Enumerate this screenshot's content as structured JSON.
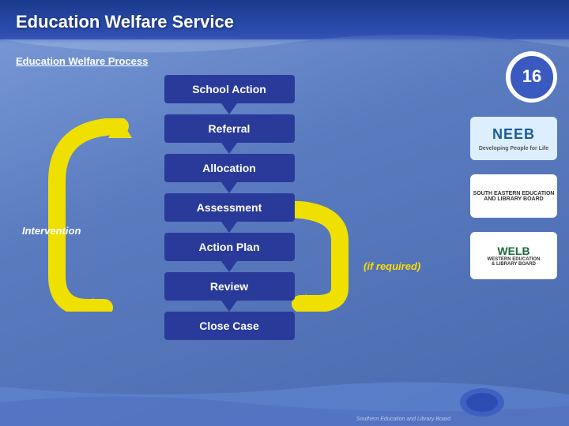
{
  "header": {
    "title": "Education Welfare Service"
  },
  "page": {
    "subtitle": "Education Welfare Process"
  },
  "flow": {
    "items": [
      {
        "id": "school-action",
        "label": "School Action"
      },
      {
        "id": "referral",
        "label": "Referral"
      },
      {
        "id": "allocation",
        "label": "Allocation"
      },
      {
        "id": "assessment",
        "label": "Assessment"
      },
      {
        "id": "action-plan",
        "label": "Action Plan"
      },
      {
        "id": "review",
        "label": "Review"
      },
      {
        "id": "close-case",
        "label": "Close Case"
      }
    ]
  },
  "labels": {
    "intervention": "Intervention",
    "if_required": "(if required)"
  },
  "logos": [
    {
      "id": "logo1",
      "alt": "Education Logo"
    },
    {
      "id": "logo2",
      "alt": "NEEB Logo"
    },
    {
      "id": "logo3",
      "alt": "SEELB Logo"
    },
    {
      "id": "logo4",
      "alt": "WELB Logo"
    }
  ]
}
